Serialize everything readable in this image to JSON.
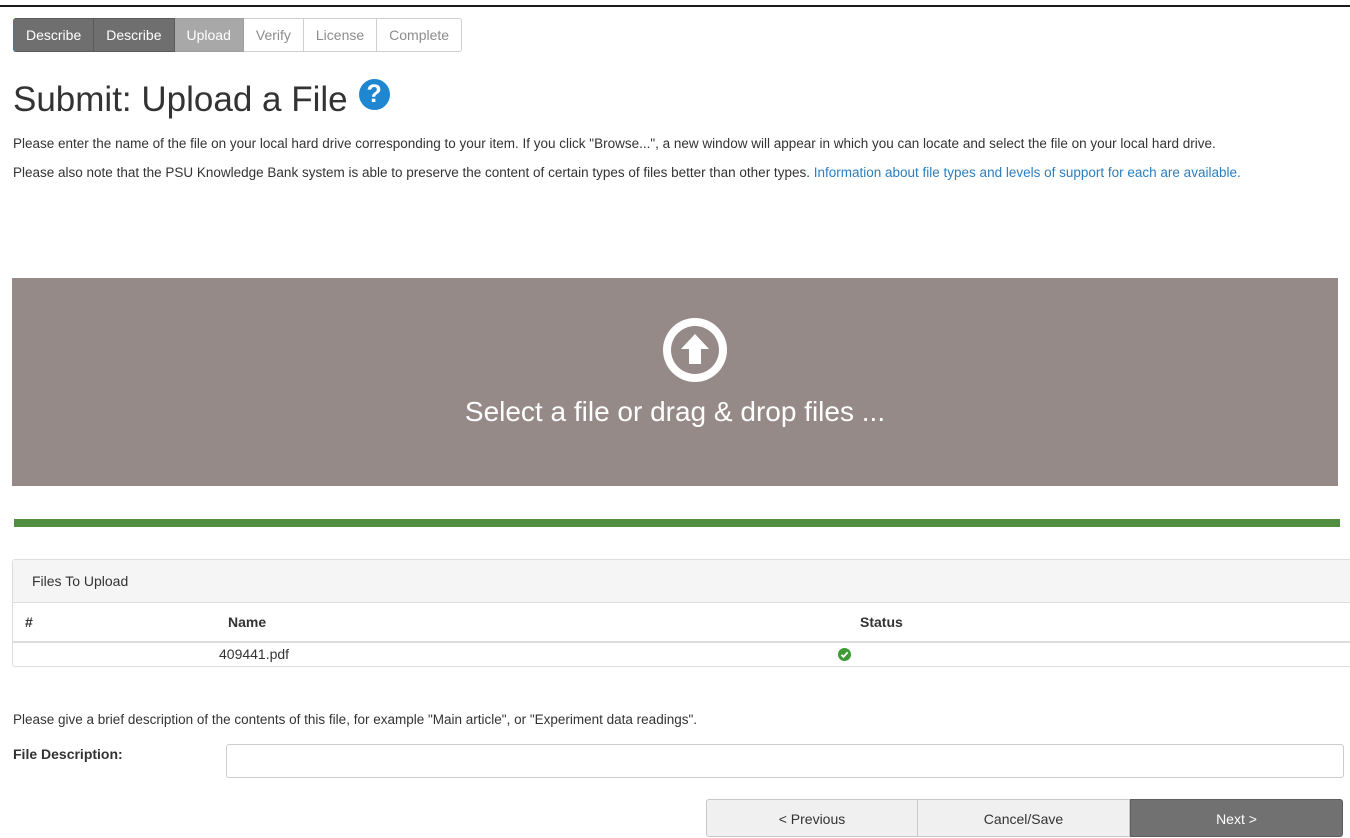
{
  "steps": [
    {
      "label": "Describe",
      "state": "done"
    },
    {
      "label": "Describe",
      "state": "done"
    },
    {
      "label": "Upload",
      "state": "current"
    },
    {
      "label": "Verify",
      "state": "pending"
    },
    {
      "label": "License",
      "state": "pending"
    },
    {
      "label": "Complete",
      "state": "pending"
    }
  ],
  "page": {
    "title": "Submit: Upload a File",
    "help_glyph": "?",
    "intro_1": "Please enter the name of the file on your local hard drive corresponding to your item. If you click \"Browse...\", a new window will appear in which you can locate and select the file on your local hard drive.",
    "intro_2": "Please also note that the PSU Knowledge Bank system is able to preserve the content of certain types of files better than other types. ",
    "intro_link": "Information about file types and levels of support for each are available."
  },
  "dropzone": {
    "icon": "upload-circle-icon",
    "label": "Select a file or drag & drop files ..."
  },
  "upload_progress": 1.0,
  "files_panel": {
    "heading": "Files To Upload",
    "columns": {
      "num": "#",
      "name": "Name",
      "status": "Status"
    },
    "rows": [
      {
        "num": "",
        "name": "409441.pdf",
        "status_icon": "check-circle-icon"
      }
    ]
  },
  "description": {
    "prompt": "Please give a brief description of the contents of this file, for example \"Main article\", or \"Experiment data readings\".",
    "label": "File Description:",
    "value": ""
  },
  "buttons": {
    "previous": "< Previous",
    "cancel": "Cancel/Save",
    "next": "Next >"
  },
  "colors": {
    "dropzone_bg": "#958a88",
    "progress": "#4f8f3f",
    "help_icon": "#1f86d1",
    "status_ok": "#3e9a34",
    "link": "#2a7fc1"
  }
}
